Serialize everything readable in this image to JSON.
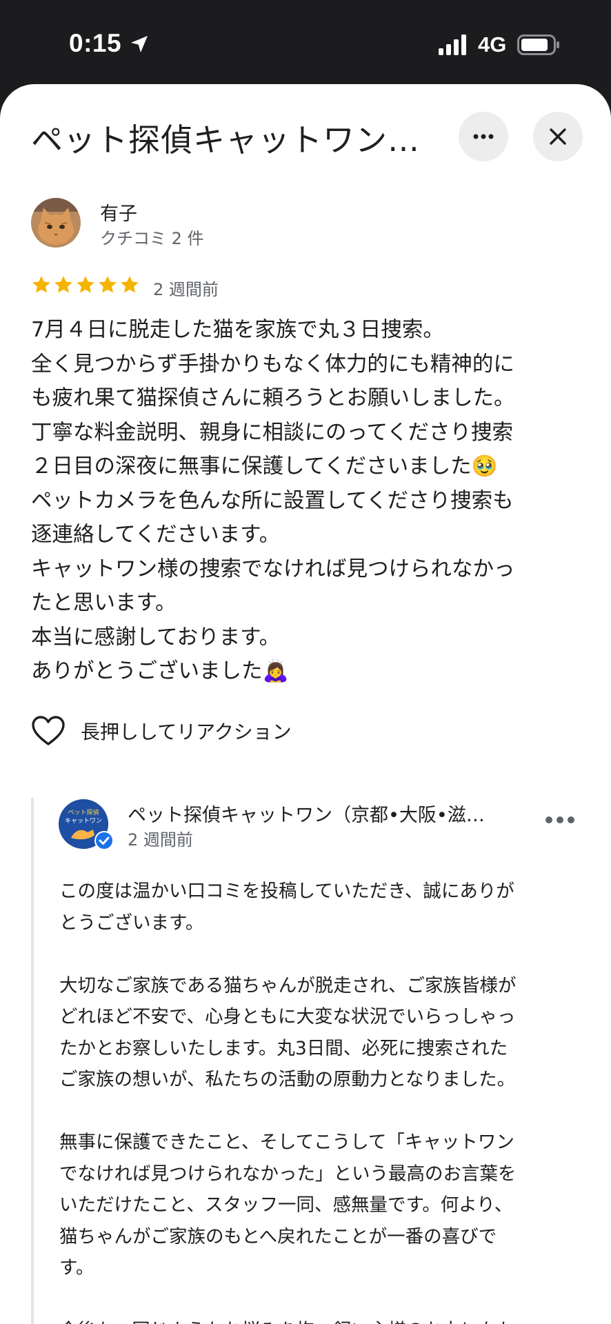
{
  "status_bar": {
    "time": "0:15",
    "network": "4G"
  },
  "header": {
    "title": "ペット探偵キャットワン…",
    "more_icon": "more-horizontal-icon",
    "close_icon": "close-icon"
  },
  "review": {
    "reviewer_name": "有子",
    "reviewer_meta": "クチコミ 2 件",
    "rating": 5,
    "date": "2 週間前",
    "lines": [
      "7月４日に脱走した猫を家族で丸３日捜索。",
      "全く見つからず手掛かりもなく体力的にも精神的に",
      "も疲れ果て猫探偵さんに頼ろうとお願いしました。",
      "丁寧な料金説明、親身に相談にのってくださり捜索",
      "２日目の深夜に無事に保護してくださいました🥹",
      "ペットカメラを色んな所に設置してくださり捜索も",
      "逐連絡してくださいます。",
      "キャットワン様の捜索でなければ見つけられなかっ",
      "たと思います。",
      "本当に感謝しております。",
      "ありがとうございました🙇‍♀️"
    ],
    "reaction_label": "長押ししてリアクション"
  },
  "owner_reply": {
    "name": "ペット探偵キャットワン（京都•大阪•滋…",
    "date": "2 週間前",
    "logo_text": [
      "ペット探偵",
      "キャットワン"
    ],
    "lines": [
      "この度は温かい口コミを投稿していただき、誠にありが",
      "とうございます。",
      "",
      "大切なご家族である猫ちゃんが脱走され、ご家族皆様が",
      "どれほど不安で、心身ともに大変な状況でいらっしゃっ",
      "たかとお察しいたします。丸3日間、必死に捜索された",
      "ご家族の想いが、私たちの活動の原動力となりました。",
      "",
      "無事に保護できたこと、そしてこうして「キャットワン",
      "でなければ見つけられなかった」という最高のお言葉を",
      "いただけたこと、スタッフ一同、感無量です。何より、",
      "猫ちゃんがご家族のもとへ戻れたことが一番の喜びで",
      "す。",
      "",
      "今後も、同じようなお悩みを抱つ飼い主様のお力になれ"
    ]
  },
  "colors": {
    "star": "#f5b400",
    "secondary_text": "#5f6368",
    "verified": "#1a73e8"
  }
}
